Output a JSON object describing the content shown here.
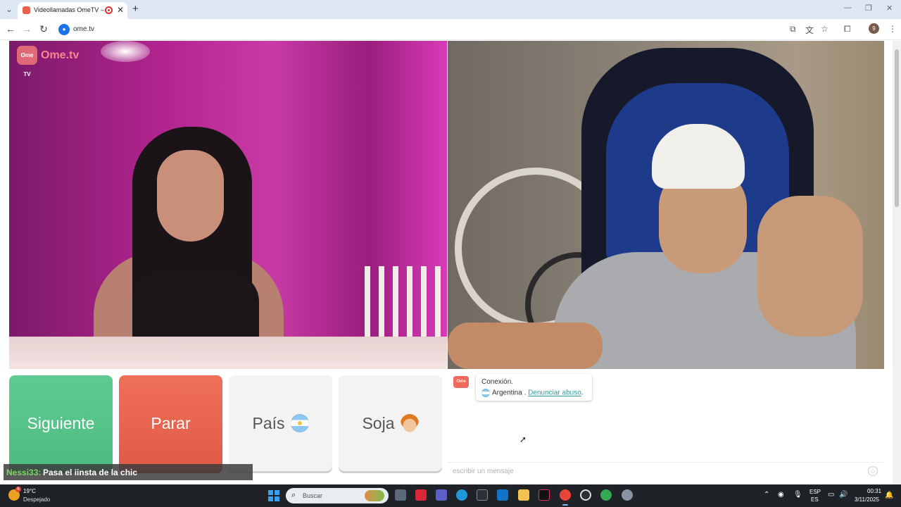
{
  "browser": {
    "tab_title": "Videollamadas OmeTV — /",
    "new_tab_glyph": "+",
    "url": "ome.tv",
    "profile_initial": "9"
  },
  "page": {
    "logo_text": "Ome.tv",
    "logo_badge": "Ome TV",
    "buttons": {
      "next": "Siguiente",
      "stop": "Parar",
      "country": "País",
      "gender": "Soja"
    },
    "chat": {
      "logo": "Ome TV",
      "connection_label": "Conexión.",
      "country": "Argentina .",
      "report_link": "Denunciar abuso",
      "report_suffix": ".",
      "input_placeholder": "escribir un mensaje"
    },
    "overlay": {
      "username": "Nessi33:",
      "message": "Pasa el iinsta de la chic"
    }
  },
  "taskbar": {
    "weather_badge": "6",
    "temperature": "19°C",
    "condition": "Despejado",
    "search_placeholder": "Buscar",
    "language_line1": "ESP",
    "language_line2": "ES",
    "time": "00:31",
    "date": "3/11/2025"
  },
  "colors": {
    "next_button": "#4dbb80",
    "stop_button": "#e05a45",
    "report_link": "#2d9a9a",
    "overlay_username": "#7fd46a"
  },
  "icons": [
    "tab-list-icon",
    "record-icon",
    "close-icon",
    "back-icon",
    "forward-icon",
    "reload-icon",
    "install-icon",
    "translate-icon",
    "star-icon",
    "extensions-icon",
    "menu-icon",
    "smile-icon",
    "search-icon",
    "windows-start-icon"
  ]
}
